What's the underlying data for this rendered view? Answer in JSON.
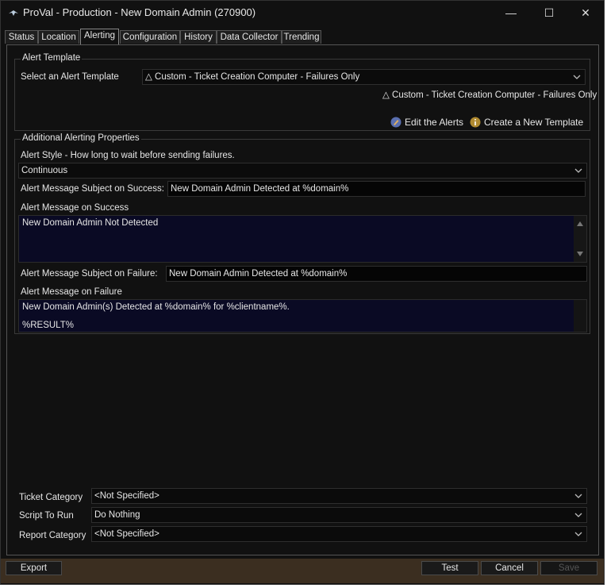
{
  "window": {
    "title": "ProVal - Production - New Domain Admin (270900)",
    "controls": {
      "minimize": "—",
      "maximize": "☐",
      "close": "✕"
    }
  },
  "tabs": [
    {
      "label": "Status"
    },
    {
      "label": "Location"
    },
    {
      "label": "Alerting",
      "active": true
    },
    {
      "label": "Configuration"
    },
    {
      "label": "History"
    },
    {
      "label": "Data Collector"
    },
    {
      "label": "Trending"
    }
  ],
  "alert_template": {
    "group_label": "Alert Template",
    "select_label": "Select an Alert Template",
    "selected": "△ Custom - Ticket Creation Computer - Failures Only",
    "caption": "△ Custom - Ticket Creation Computer - Failures Only",
    "edit_link": "Edit the Alerts",
    "create_link": "Create a New Template"
  },
  "additional": {
    "group_label": "Additional Alerting Properties",
    "style_label": "Alert Style - How long to wait before sending failures.",
    "style_value": "Continuous",
    "success_subject_label": "Alert Message Subject on Success:",
    "success_subject_value": "New Domain Admin Detected at %domain%",
    "success_message_label": "Alert Message on Success",
    "success_message_value": "New Domain Admin Not Detected",
    "failure_subject_label": "Alert Message Subject on Failure:",
    "failure_subject_value": "New Domain Admin Detected at %domain%",
    "failure_message_label": "Alert Message on Failure",
    "failure_message_line1": "New Domain Admin(s) Detected at %domain% for %clientname%.",
    "failure_message_line2": "%RESULT%"
  },
  "bottom_fields": {
    "ticket_category_label": "Ticket Category",
    "ticket_category_value": "<Not Specified>",
    "script_label": "Script To Run",
    "script_value": "Do Nothing",
    "report_category_label": "Report Category",
    "report_category_value": "<Not Specified>"
  },
  "buttons": {
    "export": "Export",
    "test": "Test",
    "cancel": "Cancel",
    "save": "Save"
  },
  "colors": {
    "background": "#111111",
    "textarea_bg": "#0a0a24",
    "bottom_bar": "#3b2e20"
  }
}
